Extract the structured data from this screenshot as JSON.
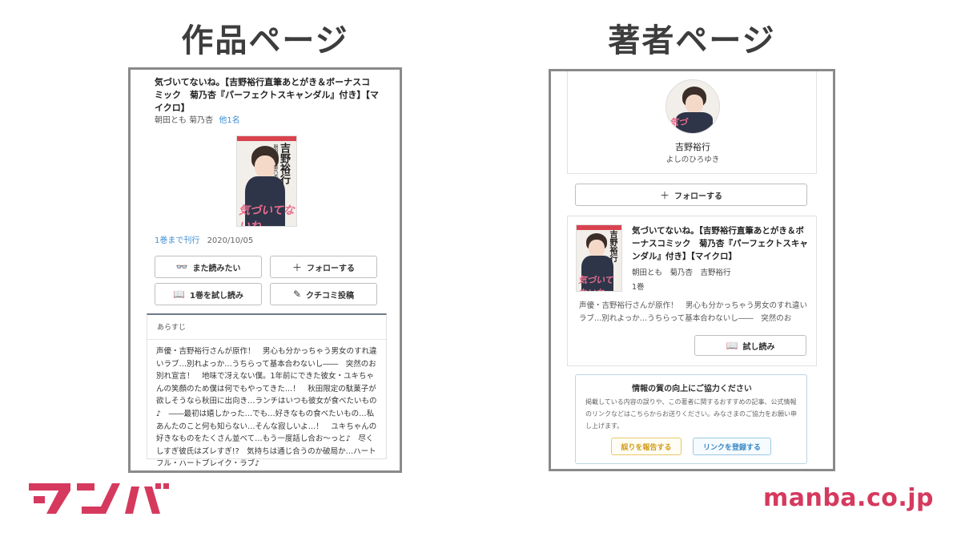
{
  "headers": {
    "left": "作品ページ",
    "right": "著者ページ"
  },
  "work_page": {
    "title": "気づいてないね。【吉野裕行直筆あとがき＆ボーナスコミック　菊乃杏『パーフェクトスキャンダル』付き】【マイクロ】",
    "authors": "朝田とも 菊乃杏",
    "authors_more": "他1名",
    "cover": {
      "title": "吉野裕行",
      "subtitle": "朝田とも 菊乃杏",
      "tagline": "気づいてないね"
    },
    "release_label": "1巻まで刊行",
    "release_date": "2020/10/05",
    "buttons": {
      "want": "また読みたい",
      "follow": "フォローする",
      "trial": "1巻を試し読み",
      "review": "クチコミ投稿"
    },
    "synopsis_label": "あらすじ",
    "synopsis": "声優・吉野裕行さんが原作！　男心も分かっちゃう男女のすれ違いラブ…別れよっか…うちらって基本合わないし――　突然のお別れ宣言！　地味で冴えない僕。1年前にできた彼女・ユキちゃんの笑顔のため僕は何でもやってきた…！　秋田限定の駄菓子が欲しそうなら秋田に出向き…ランチはいつも彼女が食べたいもの♪　――最初は嬉しかった…でも…好きなもの食べたいもの…私あんたのこと何も知らない…そんな寂しいよ…！　ユキちゃんの好きなものをたくさん並べて…もう一度話し合お〜っと♪　尽くしすぎ彼氏はズレすぎ!?　気持ちは通じ合うのか破局か…ハートフル・ハートブレイク・ラブ♪"
  },
  "author_page": {
    "name": "吉野裕行",
    "kana": "よしのひろゆき",
    "follow": "フォローする",
    "book": {
      "title": "気づいてないね。【吉野裕行直筆あとがき＆ボーナスコミック　菊乃杏『パーフェクトスキャンダル』付き】【マイクロ】",
      "authors": "朝田とも　菊乃杏　吉野裕行",
      "volume": "1巻",
      "description": "声優・吉野裕行さんが原作！　男心も分かっちゃう男女のすれ違いラブ…別れよっか…うちらって基本合わないし――　突然のお",
      "trial": "試し読み"
    },
    "info": {
      "title": "情報の質の向上にご協力ください",
      "text": "掲載している内容の誤りや、この著者に関するおすすめの記事、公式情報のリンクなどはこちらからお送りください。みなさまのご協力をお願い申し上げます。",
      "report": "誤りを報告する",
      "register": "リンクを登録する"
    }
  },
  "brand": {
    "logo": "マンバ",
    "url": "manba.co.jp",
    "color": "#d6395e"
  }
}
